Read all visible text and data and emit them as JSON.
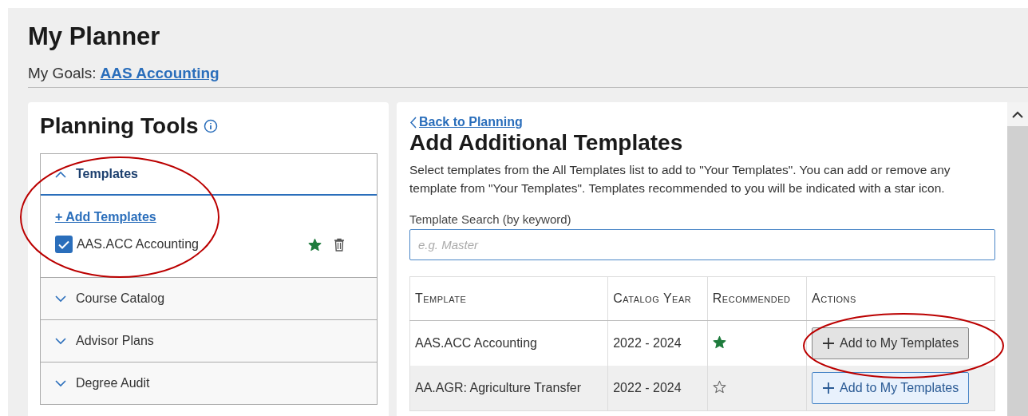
{
  "page": {
    "title": "My Planner",
    "goals_label": "My Goals:",
    "goal_link": "AAS Accounting"
  },
  "planning_tools": {
    "title": "Planning Tools",
    "sections": [
      {
        "label": "Templates",
        "expanded": true,
        "highlighted": true,
        "add_link": "+ Add Templates",
        "items": [
          {
            "label": "AAS.ACC Accounting",
            "checked": true,
            "recommended": true
          }
        ]
      },
      {
        "label": "Course Catalog",
        "expanded": false,
        "highlighted": false
      },
      {
        "label": "Advisor Plans",
        "expanded": false,
        "highlighted": false
      },
      {
        "label": "Degree Audit",
        "expanded": false,
        "highlighted": false
      }
    ]
  },
  "templates_panel": {
    "back_link": "Back to Planning",
    "title": "Add Additional Templates",
    "description": "Select templates from the All Templates list to add to \"Your Templates\". You can add or remove any template from \"Your Templates\". Templates recommended to you will be indicated with a star icon.",
    "search": {
      "label": "Template Search (by keyword)",
      "placeholder": "e.g. Master"
    },
    "table": {
      "columns": [
        "Template",
        "Catalog Year",
        "Recommended",
        "Actions"
      ],
      "rows": [
        {
          "template": "AAS.ACC Accounting",
          "catalog_year": "2022 - 2024",
          "recommended": true,
          "hovered": false,
          "action": {
            "label": "Add to My Templates",
            "pressed": true,
            "highlighted": true
          }
        },
        {
          "template": "AA.AGR: Agriculture Transfer",
          "catalog_year": "2022 - 2024",
          "recommended": false,
          "hovered": true,
          "action": {
            "label": "Add to My Templates",
            "pressed": false,
            "highlighted": false
          }
        }
      ]
    }
  }
}
